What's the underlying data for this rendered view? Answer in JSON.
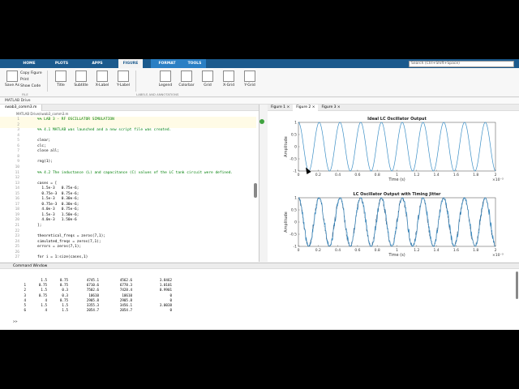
{
  "ribbon": {
    "tabs": [
      "HOME",
      "PLOTS",
      "APPS",
      "FIGURE",
      "FORMAT",
      "TOOLS"
    ],
    "active_tab": "FIGURE",
    "search_placeholder": "Search (Ctrl+Shift+Space)",
    "save_as": "Save As",
    "file_group": "FILE",
    "copy_figure": "Copy Figure",
    "print": "Print",
    "show_code": "Show Code",
    "buttons": [
      "Title",
      "Subtitle",
      "X-Label",
      "Y-Label",
      "Legend",
      "Colorbar",
      "Grid",
      "X-Grid",
      "Y-Grid"
    ],
    "group_label": "LABELS AND ANNOTATIONS"
  },
  "breadcrumb": "MATLAB Drive",
  "editor": {
    "tab": "swab3_comm3.m",
    "path": "MATLAB Drive/swab3_comm3.m",
    "lines": [
      {
        "n": "1",
        "t": "%% LAB 3 - RF OSCILLATOR SIMULATION",
        "c": true,
        "h": true
      },
      {
        "n": "2",
        "t": "",
        "c": false,
        "h": true
      },
      {
        "n": "3",
        "t": "%% 4.1 MATLAB was launched and a new script file was created.",
        "c": true,
        "h": false
      },
      {
        "n": "4",
        "t": "",
        "c": false,
        "h": false
      },
      {
        "n": "5",
        "t": "clear;",
        "c": false,
        "h": false
      },
      {
        "n": "6",
        "t": "clc;",
        "c": false,
        "h": false
      },
      {
        "n": "7",
        "t": "close all;",
        "c": false,
        "h": false
      },
      {
        "n": "8",
        "t": "",
        "c": false,
        "h": false
      },
      {
        "n": "9",
        "t": "rng(1);",
        "c": false,
        "h": false
      },
      {
        "n": "10",
        "t": "",
        "c": false,
        "h": false
      },
      {
        "n": "11",
        "t": "%% 4.2 The inductance (L) and capacitance (C) values of the LC tank circuit were defined.",
        "c": true,
        "h": false
      },
      {
        "n": "12",
        "t": "",
        "c": false,
        "h": false
      },
      {
        "n": "13",
        "t": "cases = [",
        "c": false,
        "h": false
      },
      {
        "n": "14",
        "t": "  1.5e-3   0.75e-6;",
        "c": false,
        "h": false
      },
      {
        "n": "15",
        "t": "  0.75e-3  0.75e-6;",
        "c": false,
        "h": false
      },
      {
        "n": "16",
        "t": "  1.5e-3   0.30e-6;",
        "c": false,
        "h": false
      },
      {
        "n": "17",
        "t": "  0.75e-3  0.30e-6;",
        "c": false,
        "h": false
      },
      {
        "n": "18",
        "t": "  4.0e-3   0.75e-6;",
        "c": false,
        "h": false
      },
      {
        "n": "19",
        "t": "  1.5e-3   1.50e-6;",
        "c": false,
        "h": false
      },
      {
        "n": "20",
        "t": "  4.0e-3   1.50e-6",
        "c": false,
        "h": false
      },
      {
        "n": "21",
        "t": "];",
        "c": false,
        "h": false
      },
      {
        "n": "22",
        "t": "",
        "c": false,
        "h": false
      },
      {
        "n": "23",
        "t": "theoretical_freqs = zeros(7,1);",
        "c": false,
        "h": false
      },
      {
        "n": "24",
        "t": "simulated_freqs = zeros(7,1);",
        "c": false,
        "h": false
      },
      {
        "n": "25",
        "t": "errors = zeros(7,1);",
        "c": false,
        "h": false
      },
      {
        "n": "26",
        "t": "",
        "c": false,
        "h": false
      },
      {
        "n": "27",
        "t": "for i = 1:size(cases,1)",
        "c": false,
        "h": false
      }
    ]
  },
  "figures": {
    "tabs": [
      "Figure 1",
      "Figure 2",
      "Figure 3"
    ],
    "active": "Figure 2"
  },
  "chart_data": [
    {
      "type": "line",
      "title": "Ideal LC Oscillator Output",
      "xlabel": "Time (s)",
      "ylabel": "Amplitude",
      "x_exponent": "×10⁻³",
      "xlim": [
        0,
        2
      ],
      "ylim": [
        -1,
        1
      ],
      "xticks": [
        "0",
        "0.2",
        "0.4",
        "0.6",
        "0.8",
        "1",
        "1.2",
        "1.4",
        "1.6",
        "1.8",
        "2"
      ],
      "yticks": [
        "1",
        "0.5",
        "0",
        "-0.5",
        "-1"
      ],
      "series": [
        {
          "frequency_hz": 4745.1,
          "cycles": 9.49,
          "jitter": false
        }
      ],
      "color": "#3c8fc6"
    },
    {
      "type": "line",
      "title": "LC Oscillator Output with Timing Jitter",
      "xlabel": "Time (s)",
      "ylabel": "Amplitude",
      "x_exponent": "×10⁻³",
      "xlim": [
        0,
        2
      ],
      "ylim": [
        -1,
        1
      ],
      "xticks": [
        "0",
        "0.2",
        "0.4",
        "0.6",
        "0.8",
        "1",
        "1.2",
        "1.4",
        "1.6",
        "1.8",
        "2"
      ],
      "yticks": [
        "1",
        "0.5",
        "0",
        "-0.5",
        "-1"
      ],
      "series": [
        {
          "frequency_hz": 4745.1,
          "cycles": 9.49,
          "jitter": true
        }
      ],
      "color": "#3c8fc6"
    }
  ],
  "command_window": {
    "title": "Command Window",
    "rows": [
      [
        "",
        "1.5",
        "0.75",
        "4745.1",
        "4562.6",
        "3.8462"
      ],
      [
        "1",
        "0.75",
        "0.75",
        "6710.6",
        "6778.3",
        "1.0101"
      ],
      [
        "2",
        "1.5",
        "0.3",
        "7502.6",
        "7428.4",
        "0.9901"
      ],
      [
        "3",
        "0.75",
        "0.3",
        "10610",
        "10610",
        "0"
      ],
      [
        "4",
        "4",
        "0.75",
        "2905.8",
        "2905.8",
        "0"
      ],
      [
        "5",
        "1.5",
        "1.5",
        "3355.3",
        "3456.1",
        "3.0038"
      ],
      [
        "6",
        "4",
        "1.5",
        "2054.7",
        "2054.7",
        "0"
      ]
    ],
    "prompt": ">>"
  }
}
